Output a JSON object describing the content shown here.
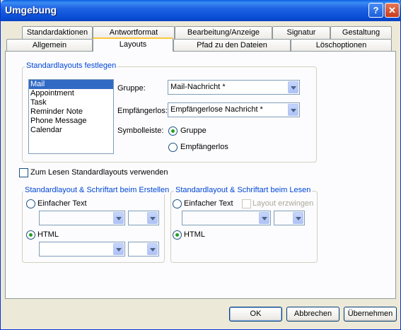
{
  "window": {
    "title": "Umgebung",
    "help_glyph": "?",
    "close_glyph": "✕"
  },
  "tabs": {
    "row1": [
      "Standardaktionen",
      "Antwortformat",
      "Bearbeitung/Anzeige",
      "Signatur",
      "Gestaltung"
    ],
    "row2": [
      "Allgemein",
      "Layouts",
      "Pfad zu den Dateien",
      "Löschoptionen"
    ],
    "active": "Layouts"
  },
  "defaults_group": {
    "legend": "Standardlayouts festlegen",
    "layout_list": [
      "Mail",
      "Appointment",
      "Task",
      "Reminder Note",
      "Phone Message",
      "Calendar"
    ],
    "selected_item": "Mail",
    "group_label": "Gruppe:",
    "group_value": "Mail-Nachricht *",
    "recipients_label": "Empfängerlos:",
    "recipients_value": "Empfängerlose Nachricht *",
    "toolbar_label": "Symbolleiste:",
    "toolbar_options": [
      "Gruppe",
      "Empfängerlos"
    ],
    "toolbar_selected": "Gruppe"
  },
  "read_defaults_checkbox": {
    "label": "Zum Lesen Standardlayouts verwenden",
    "checked": false
  },
  "create_group": {
    "legend": "Standardlayout & Schriftart beim Erstellen",
    "plain_text_label": "Einfacher Text",
    "html_label": "HTML",
    "selected": "HTML"
  },
  "read_group": {
    "legend": "Standardlayout & Schriftart beim Lesen",
    "plain_text_label": "Einfacher Text",
    "force_layout_label": "Layout erzwingen",
    "html_label": "HTML",
    "selected": "HTML"
  },
  "buttons": {
    "ok": "OK",
    "cancel": "Abbrechen",
    "apply": "Übernehmen"
  }
}
